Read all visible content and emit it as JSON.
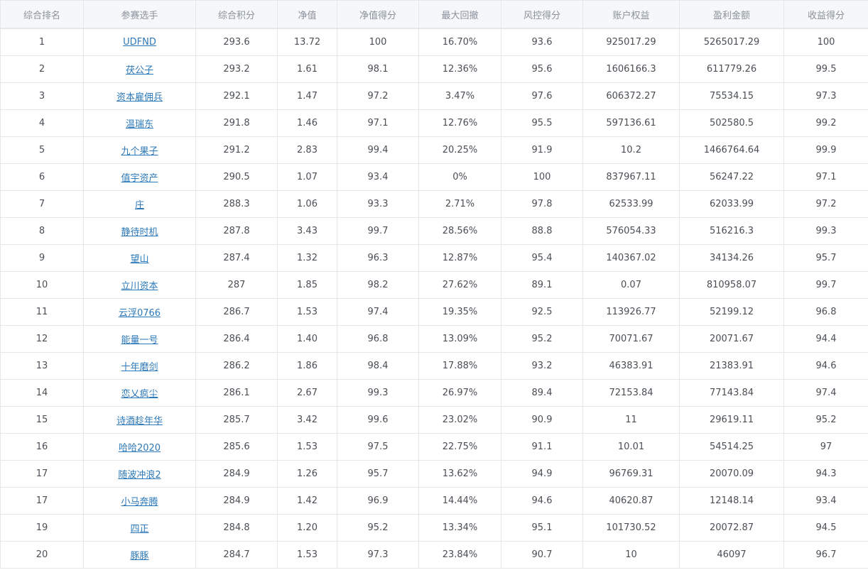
{
  "table": {
    "headers": [
      "综合排名",
      "参赛选手",
      "综合积分",
      "净值",
      "净值得分",
      "最大回撤",
      "风控得分",
      "账户权益",
      "盈利金额",
      "收益得分"
    ],
    "rows": [
      [
        "1",
        "UDFND",
        "293.6",
        "13.72",
        "100",
        "16.70%",
        "93.6",
        "925017.29",
        "5265017.29",
        "100"
      ],
      [
        "2",
        "茯公子",
        "293.2",
        "1.61",
        "98.1",
        "12.36%",
        "95.6",
        "1606166.3",
        "611779.26",
        "99.5"
      ],
      [
        "3",
        "资本雇佣兵",
        "292.1",
        "1.47",
        "97.2",
        "3.47%",
        "97.6",
        "606372.27",
        "75534.15",
        "97.3"
      ],
      [
        "4",
        "温瑞东",
        "291.8",
        "1.46",
        "97.1",
        "12.76%",
        "95.5",
        "597136.61",
        "502580.5",
        "99.2"
      ],
      [
        "5",
        "九个果子",
        "291.2",
        "2.83",
        "99.4",
        "20.25%",
        "91.9",
        "10.2",
        "1466764.64",
        "99.9"
      ],
      [
        "6",
        "值宇资产",
        "290.5",
        "1.07",
        "93.4",
        "0%",
        "100",
        "837967.11",
        "56247.22",
        "97.1"
      ],
      [
        "7",
        "庄",
        "288.3",
        "1.06",
        "93.3",
        "2.71%",
        "97.8",
        "62533.99",
        "62033.99",
        "97.2"
      ],
      [
        "8",
        "静待时机",
        "287.8",
        "3.43",
        "99.7",
        "28.56%",
        "88.8",
        "576054.33",
        "516216.3",
        "99.3"
      ],
      [
        "9",
        "望山",
        "287.4",
        "1.32",
        "96.3",
        "12.87%",
        "95.4",
        "140367.02",
        "34134.26",
        "95.7"
      ],
      [
        "10",
        "立川资本",
        "287",
        "1.85",
        "98.2",
        "27.62%",
        "89.1",
        "0.07",
        "810958.07",
        "99.7"
      ],
      [
        "11",
        "云浮0766",
        "286.7",
        "1.53",
        "97.4",
        "19.35%",
        "92.5",
        "113926.77",
        "52199.12",
        "96.8"
      ],
      [
        "12",
        "能量一号",
        "286.4",
        "1.40",
        "96.8",
        "13.09%",
        "95.2",
        "70071.67",
        "20071.67",
        "94.4"
      ],
      [
        "13",
        "十年磨剑",
        "286.2",
        "1.86",
        "98.4",
        "17.88%",
        "93.2",
        "46383.91",
        "21383.91",
        "94.6"
      ],
      [
        "14",
        "恋乂疯尘",
        "286.1",
        "2.67",
        "99.3",
        "26.97%",
        "89.4",
        "72153.84",
        "77143.84",
        "97.4"
      ],
      [
        "15",
        "诗酒趁年华",
        "285.7",
        "3.42",
        "99.6",
        "23.02%",
        "90.9",
        "11",
        "29619.11",
        "95.2"
      ],
      [
        "16",
        "哈哈2020",
        "285.6",
        "1.53",
        "97.5",
        "22.75%",
        "91.1",
        "10.01",
        "54514.25",
        "97"
      ],
      [
        "17",
        "随波冲浪2",
        "284.9",
        "1.26",
        "95.7",
        "13.62%",
        "94.9",
        "96769.31",
        "20070.09",
        "94.3"
      ],
      [
        "17",
        "小马奔腾",
        "284.9",
        "1.42",
        "96.9",
        "14.44%",
        "94.6",
        "40620.87",
        "12148.14",
        "93.4"
      ],
      [
        "19",
        "四正",
        "284.8",
        "1.20",
        "95.2",
        "13.34%",
        "95.1",
        "101730.52",
        "20072.87",
        "94.5"
      ],
      [
        "20",
        "豚豚",
        "284.7",
        "1.53",
        "97.3",
        "23.84%",
        "90.7",
        "10",
        "46097",
        "96.7"
      ]
    ]
  }
}
